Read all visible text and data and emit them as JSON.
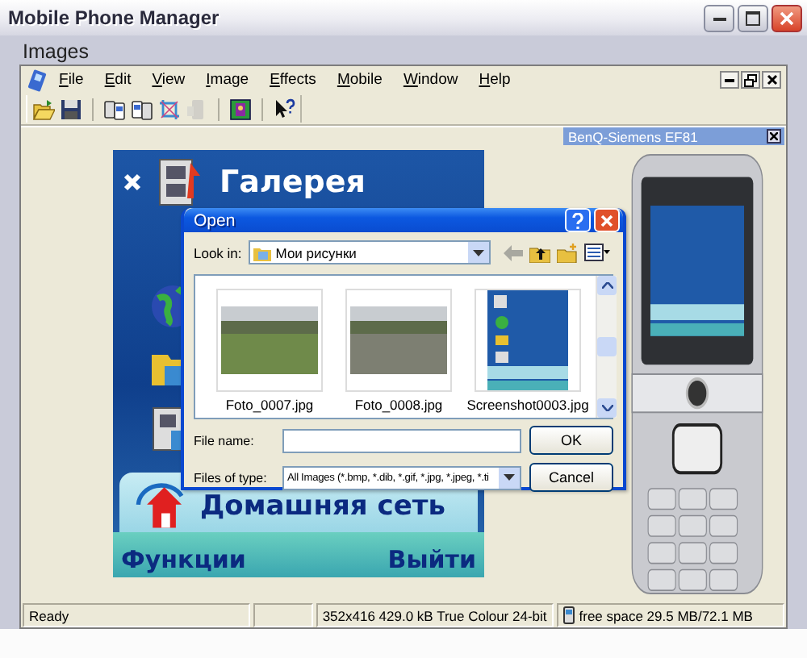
{
  "window": {
    "title": "Mobile Phone Manager"
  },
  "workspace_label": "Images",
  "menu": [
    "File",
    "Edit",
    "View",
    "Image",
    "Effects",
    "Mobile",
    "Window",
    "Help"
  ],
  "toolbar": [
    {
      "kind": "open",
      "disabled": false
    },
    {
      "kind": "save",
      "disabled": false
    },
    {
      "kind": "copy_to",
      "disabled": false
    },
    {
      "kind": "copy_from",
      "disabled": false
    },
    {
      "kind": "crop",
      "disabled": false
    },
    {
      "kind": "send",
      "disabled": true
    },
    {
      "kind": "frame",
      "disabled": false
    },
    {
      "kind": "help",
      "disabled": false
    }
  ],
  "image": {
    "title": "Галерея",
    "selected_item": "Домашняя сеть",
    "left_softkey": "Функции",
    "right_softkey": "Выйти"
  },
  "device_panel": {
    "title": "BenQ-Siemens EF81"
  },
  "open_dialog": {
    "title": "Open",
    "look_in_label": "Look in:",
    "look_in": "Мои рисунки",
    "files": [
      {
        "name": "Foto_0007.jpg",
        "kind": "photo"
      },
      {
        "name": "Foto_0008.jpg",
        "kind": "photo"
      },
      {
        "name": "Screenshot0003.jpg",
        "kind": "screenshot"
      }
    ],
    "file_name_label": "File name:",
    "files_of_type_label": "Files of type:",
    "files_of_type": "All Images (*.bmp, *.dib, *.gif, *.jpg, *.jpeg, *.ti",
    "ok_button": "OK",
    "cancel_button": "Cancel"
  },
  "status_bar": {
    "message": "Ready",
    "image_info": "352x416 429.0 kB True Colour 24-bit",
    "free_space": "free space 29.5 MB/72.1 MB"
  }
}
